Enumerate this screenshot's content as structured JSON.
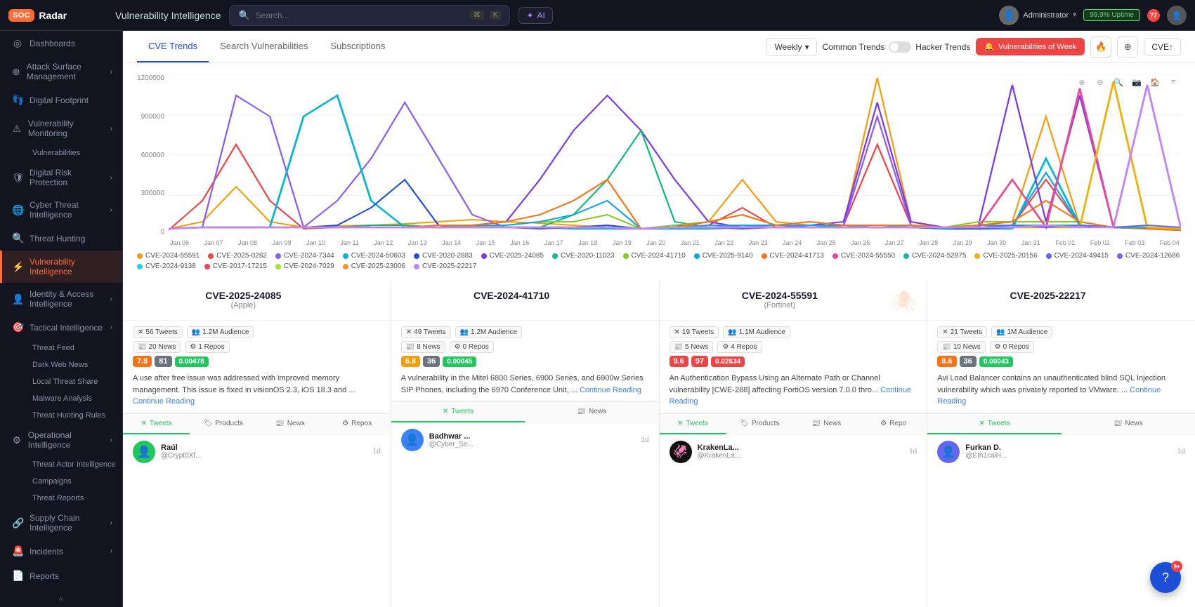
{
  "topbar": {
    "logo": "SOCRadar",
    "logo_box": "SOC",
    "logo_rest": "Radar",
    "page_title": "Vulnerability Intelligence",
    "search_placeholder": "Search...",
    "search_shortcut1": "⌘",
    "search_shortcut2": "K",
    "ai_label": "AI",
    "user_name": "Administrator",
    "green_status": "99.9% Uptime",
    "notif_count": "77",
    "user_avatar_icon": "👤"
  },
  "sidebar": {
    "items": [
      {
        "id": "dashboards",
        "label": "Dashboards",
        "icon": "◎",
        "has_chevron": false
      },
      {
        "id": "attack-surface",
        "label": "Attack Surface Management",
        "icon": "⊕",
        "has_chevron": true
      },
      {
        "id": "digital-footprint",
        "label": "Digital Footprint",
        "icon": "👣",
        "has_chevron": false
      },
      {
        "id": "vuln-monitoring",
        "label": "Vulnerability Monitoring",
        "icon": "⚠",
        "has_chevron": true
      },
      {
        "id": "vulnerabilities",
        "label": "Vulnerabilities",
        "icon": "",
        "is_sub": true
      },
      {
        "id": "digital-risk",
        "label": "Digital Risk Protection",
        "icon": "🛡",
        "has_chevron": true
      },
      {
        "id": "cyber-threat",
        "label": "Cyber Threat Intelligence",
        "icon": "🌐",
        "has_chevron": true
      },
      {
        "id": "threat-hunting",
        "label": "Threat Hunting",
        "icon": "🔍",
        "has_chevron": false
      },
      {
        "id": "vuln-intelligence",
        "label": "Vulnerability Intelligence",
        "icon": "⚡",
        "has_chevron": false,
        "active": true
      },
      {
        "id": "identity-access",
        "label": "Identity & Access Intelligence",
        "icon": "👤",
        "has_chevron": true
      },
      {
        "id": "tactical-intel",
        "label": "Tactical Intelligence",
        "icon": "🎯",
        "has_chevron": true
      },
      {
        "id": "threat-feed",
        "label": "Threat Feed",
        "icon": "",
        "is_sub": true
      },
      {
        "id": "dark-web",
        "label": "Dark Web News",
        "icon": "",
        "is_sub": true
      },
      {
        "id": "local-threat",
        "label": "Local Threat Share",
        "icon": "",
        "is_sub": true
      },
      {
        "id": "malware-analysis",
        "label": "Malware Analysis",
        "icon": "",
        "is_sub": true
      },
      {
        "id": "threat-hunting-rules",
        "label": "Threat Hunting Rules",
        "icon": "",
        "is_sub": true
      },
      {
        "id": "operational-intel",
        "label": "Operational Intelligence",
        "icon": "⚙",
        "has_chevron": true
      },
      {
        "id": "threat-actor",
        "label": "Threat Actor Intelligence",
        "icon": "",
        "is_sub": true
      },
      {
        "id": "campaigns",
        "label": "Campaigns",
        "icon": "",
        "is_sub": true
      },
      {
        "id": "threat-reports",
        "label": "Threat Reports",
        "icon": "",
        "is_sub": true
      },
      {
        "id": "supply-chain",
        "label": "Supply Chain Intelligence",
        "icon": "🔗",
        "has_chevron": true
      },
      {
        "id": "incidents",
        "label": "Incidents",
        "icon": "🚨",
        "has_chevron": true
      },
      {
        "id": "reports",
        "label": "Reports",
        "icon": "📄",
        "has_chevron": false
      }
    ],
    "collapse_label": "<<"
  },
  "tabs": {
    "items": [
      {
        "id": "cve-trends",
        "label": "CVE Trends",
        "active": true
      },
      {
        "id": "search-vulns",
        "label": "Search Vulnerabilities",
        "active": false
      },
      {
        "id": "subscriptions",
        "label": "Subscriptions",
        "active": false
      }
    ],
    "weekly_label": "Weekly",
    "common_trends_label": "Common Trends",
    "hacker_trends_label": "Hacker Trends",
    "vuln_week_label": "Vulnerabilities of Week",
    "cve_label": "CVE↑"
  },
  "chart": {
    "title": "CVE Trends",
    "y_labels": [
      "1200000",
      "900000",
      "600000",
      "300000",
      "0"
    ],
    "x_labels": [
      "Jan 06",
      "Jan 07",
      "Jan 08",
      "Jan 09",
      "Jan 10",
      "Jan 11",
      "Jan 12",
      "Jan 13",
      "Jan 14",
      "Jan 15",
      "Jan 16",
      "Jan 17",
      "Jan 18",
      "Jan 19",
      "Jan 20",
      "Jan 21",
      "Jan 22",
      "Jan 23",
      "Jan 24",
      "Jan 25",
      "Jan 26",
      "Jan 27",
      "Jan 28",
      "Jan 29",
      "Jan 30",
      "Jan 31",
      "Feb 01",
      "Feb 02",
      "Feb 03",
      "Feb 04"
    ],
    "legend": [
      {
        "id": "cve1",
        "label": "CVE-2024-55591",
        "color": "#f59e0b"
      },
      {
        "id": "cve2",
        "label": "CVE-2025-0282",
        "color": "#ef4444"
      },
      {
        "id": "cve3",
        "label": "CVE-2024-7344",
        "color": "#8b5cf6"
      },
      {
        "id": "cve4",
        "label": "CVE-2024-50603",
        "color": "#06b6d4"
      },
      {
        "id": "cve5",
        "label": "CVE-2020-2883",
        "color": "#1d4ed8"
      },
      {
        "id": "cve6",
        "label": "CVE-2025-24085",
        "color": "#7c3aed"
      },
      {
        "id": "cve7",
        "label": "CVE-2020-11023",
        "color": "#10b981"
      },
      {
        "id": "cve8",
        "label": "CVE-2024-41710",
        "color": "#84cc16"
      },
      {
        "id": "cve9",
        "label": "CVE-2025-9140",
        "color": "#0ea5e9"
      },
      {
        "id": "cve10",
        "label": "CVE-2024-41713",
        "color": "#f97316"
      },
      {
        "id": "cve11",
        "label": "CVE-2024-55550",
        "color": "#ec4899"
      },
      {
        "id": "cve12",
        "label": "CVE-2024-52875",
        "color": "#14b8a6"
      },
      {
        "id": "cve13",
        "label": "CVE-2025-20156",
        "color": "#f59e0b"
      },
      {
        "id": "cve14",
        "label": "CVE-2024-49415",
        "color": "#6366f1"
      },
      {
        "id": "cve15",
        "label": "CVE-2024-12686",
        "color": "#8b5cf6"
      },
      {
        "id": "cve16",
        "label": "CVE-2024-9138",
        "color": "#22d3ee"
      },
      {
        "id": "cve17",
        "label": "CVE-2017-17215",
        "color": "#f43f5e"
      },
      {
        "id": "cve18",
        "label": "CVE-2024-7029",
        "color": "#a3e635"
      },
      {
        "id": "cve19",
        "label": "CVE-2025-23006",
        "color": "#fb923c"
      },
      {
        "id": "cve20",
        "label": "CVE-2025-22217",
        "color": "#c084fc"
      }
    ]
  },
  "cve_cards": [
    {
      "id": "cve-2025-24085",
      "title": "CVE-2025-24085",
      "vendor": "(Apple)",
      "tweets": "56 Tweets",
      "audience": "1.2M Audience",
      "news": "20 News",
      "repos": "1 Repos",
      "score1": "7.8",
      "score2": "81",
      "score3": "0.00478",
      "score3_color": "green",
      "description": "A use after free issue was addressed with improved memory management. This issue is fixed in visionOS 2.3, iOS 18.3 and ...",
      "continue_reading": "Continue Reading",
      "tabs": [
        "Tweets",
        "Products",
        "News",
        "Repos"
      ],
      "active_tab": "Tweets",
      "tweet_user": "Raúl",
      "tweet_handle": "@Crypt0Xf...",
      "tweet_time": "1d",
      "tweet_avatar_color": "#22c55e",
      "tweet_avatar_emoji": "👤"
    },
    {
      "id": "cve-2024-41710",
      "title": "CVE-2024-41710",
      "vendor": "",
      "tweets": "49 Tweets",
      "audience": "1.2M Audience",
      "news": "8 News",
      "repos": "0 Repos",
      "score1": "6.8",
      "score2": "36",
      "score3": "0.00045",
      "score3_color": "green",
      "description": "A vulnerability in the Mitel 6800 Series, 6900 Series, and 6900w Series SIP Phones, including the 6970 Conference Unit, ...",
      "continue_reading": "Continue Reading",
      "tabs": [
        "Tweets",
        "News"
      ],
      "active_tab": "Tweets",
      "tweet_user": "Badhwar ...",
      "tweet_handle": "@Cyber_Se...",
      "tweet_time": "1d",
      "tweet_avatar_color": "#3b82f6",
      "tweet_avatar_emoji": "👤"
    },
    {
      "id": "cve-2024-55591",
      "title": "CVE-2024-55591",
      "vendor": "(Fortinet)",
      "tweets": "19 Tweets",
      "audience": "1.1M Audience",
      "news": "5 News",
      "repos": "4 Repos",
      "score1": "9.6",
      "score2": "97",
      "score3": "0.02634",
      "score3_color": "red",
      "description": "An Authentication Bypass Using an Alternate Path or Channel vulnerability [CWE-288] affecting FortiOS version 7.0.0 thro...",
      "continue_reading": "Continue Reading",
      "tabs": [
        "Tweets",
        "Products",
        "News",
        "Repo"
      ],
      "active_tab": "Tweets",
      "tweet_user": "KrakenLa...",
      "tweet_handle": "@KrakenLa...",
      "tweet_time": "1d",
      "tweet_avatar_color": "#111",
      "tweet_avatar_emoji": "🦑"
    },
    {
      "id": "cve-2025-22217",
      "title": "CVE-2025-22217",
      "vendor": "",
      "tweets": "21 Tweets",
      "audience": "1M Audience",
      "news": "10 News",
      "repos": "0 Repos",
      "score1": "8.6",
      "score2": "36",
      "score3": "0.00043",
      "score3_color": "green",
      "description": "Avi Load Balancer contains an unauthenticated blind SQL Injection vulnerability which was privately reported to VMware. ...",
      "continue_reading": "Continue Reading",
      "tabs": [
        "Tweets",
        "News"
      ],
      "active_tab": "Tweets",
      "tweet_user": "Furkan D.",
      "tweet_handle": "@Eth1calH...",
      "tweet_time": "1d",
      "tweet_avatar_color": "#6366f1",
      "tweet_avatar_emoji": "👤"
    }
  ],
  "help": {
    "icon": "?",
    "notif_count": "9+"
  }
}
